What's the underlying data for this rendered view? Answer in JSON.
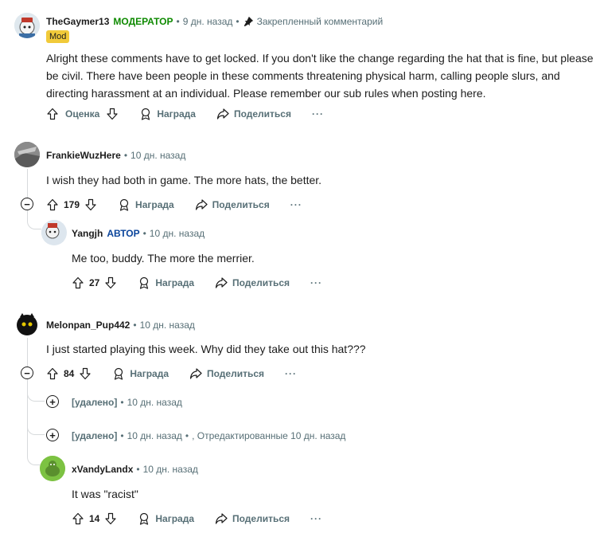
{
  "comments": {
    "c1": {
      "author": "TheGaymer13",
      "mod_tag": "МОДЕРАТОР",
      "time": "9 дн. назад",
      "pinned": "Закрепленный комментарий",
      "badge": "Mod",
      "text": "Alright these comments have to get locked. If you don't like the change regarding the hat that is fine, but please be civil. There have been people in these comments threatening physical harm, calling people slurs, and directing harassment at an individual. Please remember our sub rules when posting here.",
      "vote_label": "Оценка",
      "award": "Награда",
      "share": "Поделиться",
      "more": "···"
    },
    "c2": {
      "author": "FrankieWuzHere",
      "time": "10 дн. назад",
      "text": "I wish they had both in game. The more hats, the better.",
      "votes": "179",
      "award": "Награда",
      "share": "Поделиться",
      "more": "···"
    },
    "c3": {
      "author": "Yangjh",
      "op_tag": "АВТОР",
      "time": "10 дн. назад",
      "text": "Me too, buddy. The more the merrier.",
      "votes": "27",
      "award": "Награда",
      "share": "Поделиться",
      "more": "···"
    },
    "c4": {
      "author": "Melonpan_Pup442",
      "time": "10 дн. назад",
      "text": "I just started playing this week. Why did they take out this hat???",
      "votes": "84",
      "award": "Награда",
      "share": "Поделиться",
      "more": "···"
    },
    "c5": {
      "author": "[удалено]",
      "time": "10 дн. назад"
    },
    "c6": {
      "author": "[удалено]",
      "time": "10 дн. назад",
      "edited": ", Отредактированные 10 дн. назад"
    },
    "c7": {
      "author": "xVandyLandx",
      "time": "10 дн. назад",
      "text": "It was \"racist\"",
      "votes": "14",
      "award": "Награда",
      "share": "Поделиться",
      "more": "···"
    }
  },
  "icons": {
    "upvote": "arrow-up-outline-icon",
    "downvote": "arrow-down-outline-icon",
    "award": "award-icon",
    "share": "share-arrow-icon",
    "pin": "pin-icon",
    "collapse": "minus-circle-icon",
    "expand": "plus-circle-icon"
  },
  "colors": {
    "mod_green": "#0e8a00",
    "op_blue": "#0a449b",
    "mod_badge_bg": "#f1ca3a",
    "meta_gray": "#576f76",
    "thread_line": "#d7dadc"
  }
}
